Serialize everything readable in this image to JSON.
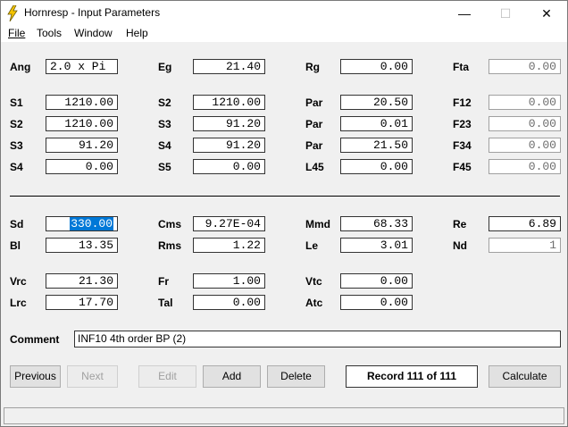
{
  "window": {
    "title": "Hornresp - Input Parameters",
    "minimize": "—",
    "maximize": "☐",
    "close": "✕"
  },
  "menu": {
    "file": "File",
    "tools": "Tools",
    "window": "Window",
    "help": "Help"
  },
  "params": {
    "ang_label": "Ang",
    "ang_value": "2.0 x Pi",
    "eg_label": "Eg",
    "eg_value": "21.40",
    "rg_label": "Rg",
    "rg_value": "0.00",
    "fta_label": "Fta",
    "fta_value": "0.00",
    "s1_label": "S1",
    "s1_value": "1210.00",
    "s2_label": "S2",
    "s2_value": "1210.00",
    "s2b_label": "S2",
    "s2b_value": "1210.00",
    "s3_label": "S3",
    "s3_value": "91.20",
    "s3b_label": "S3",
    "s3b_value": "91.20",
    "s4_label": "S4",
    "s4_value": "91.20",
    "s4b_label": "S4",
    "s4b_value": "0.00",
    "s5_label": "S5",
    "s5_value": "0.00",
    "par1_label": "Par",
    "par1_value": "20.50",
    "par2_label": "Par",
    "par2_value": "0.01",
    "par3_label": "Par",
    "par3_value": "21.50",
    "l45_label": "L45",
    "l45_value": "0.00",
    "f12_label": "F12",
    "f12_value": "0.00",
    "f23_label": "F23",
    "f23_value": "0.00",
    "f34_label": "F34",
    "f34_value": "0.00",
    "f45_label": "F45",
    "f45_value": "0.00"
  },
  "driver": {
    "sd_label": "Sd",
    "sd_value": "330.00",
    "cms_label": "Cms",
    "cms_value": "9.27E-04",
    "mmd_label": "Mmd",
    "mmd_value": "68.33",
    "re_label": "Re",
    "re_value": "6.89",
    "bl_label": "Bl",
    "bl_value": "13.35",
    "rms_label": "Rms",
    "rms_value": "1.22",
    "le_label": "Le",
    "le_value": "3.01",
    "nd_label": "Nd",
    "nd_value": "1",
    "vrc_label": "Vrc",
    "vrc_value": "21.30",
    "fr_label": "Fr",
    "fr_value": "1.00",
    "vtc_label": "Vtc",
    "vtc_value": "0.00",
    "lrc_label": "Lrc",
    "lrc_value": "17.70",
    "tal_label": "Tal",
    "tal_value": "0.00",
    "atc_label": "Atc",
    "atc_value": "0.00"
  },
  "comment": {
    "label": "Comment",
    "value": "INF10 4th order BP (2)"
  },
  "buttons": {
    "previous": "Previous",
    "next": "Next",
    "edit": "Edit",
    "add": "Add",
    "delete": "Delete",
    "calculate": "Calculate"
  },
  "record": "Record 111 of 111",
  "colors": {
    "selection": "#0078d7",
    "icon_yellow": "#f5c400"
  }
}
